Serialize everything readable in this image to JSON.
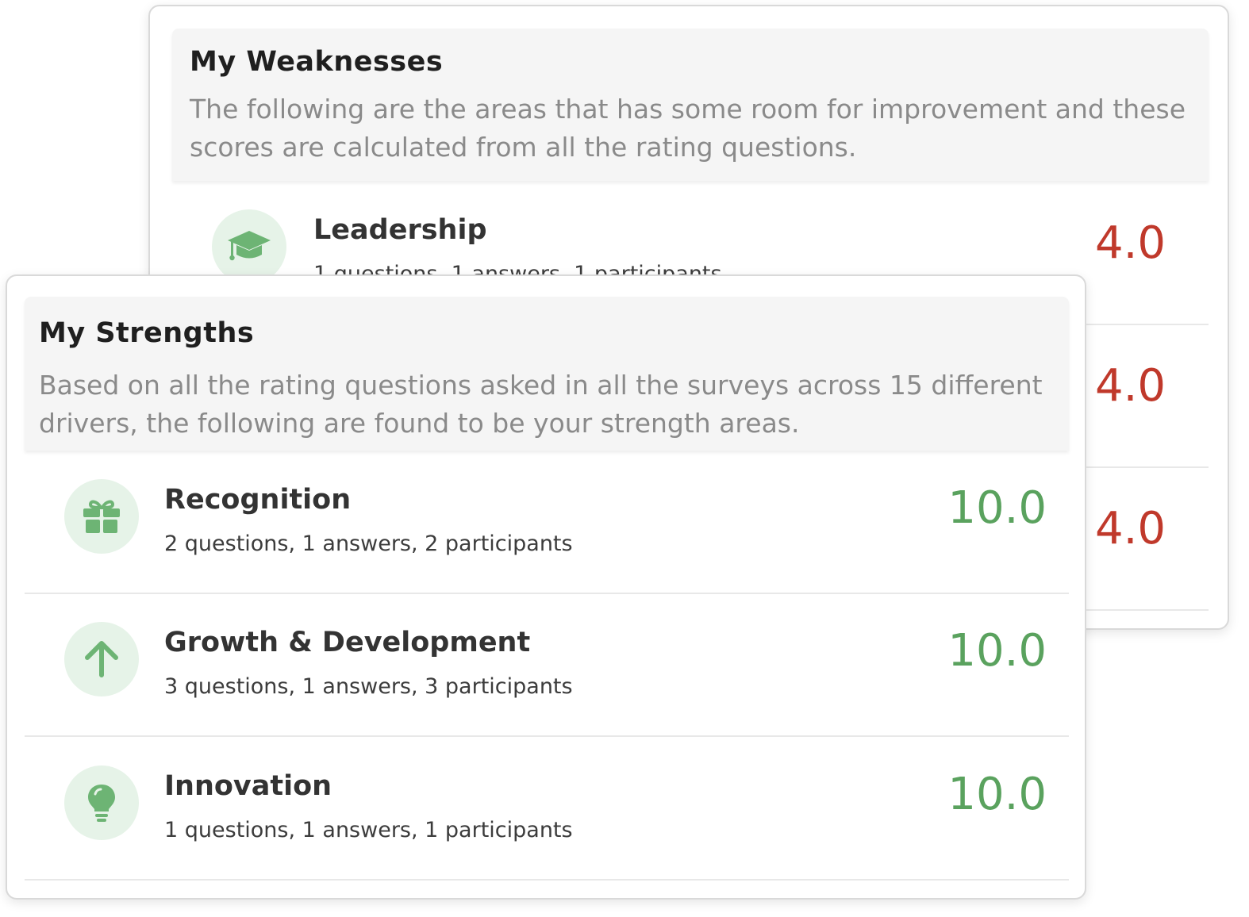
{
  "colors": {
    "weak_score": "#c0392b",
    "strong_score": "#5aa25e",
    "icon_bg": "#e6f3e8",
    "icon_fg": "#6db474",
    "header_bg": "#f5f5f5"
  },
  "weaknesses": {
    "title": "My Weaknesses",
    "description": "The following are the areas that has some room for improvement and these scores are calculated from all the rating questions.",
    "items": [
      {
        "icon": "graduation-cap-icon",
        "name": "Leadership",
        "meta": "1 questions, 1 answers, 1 participants",
        "score": "4.0"
      },
      {
        "icon": "",
        "name": "",
        "meta": "",
        "score": "4.0"
      },
      {
        "icon": "",
        "name": "",
        "meta": "",
        "score": "4.0"
      }
    ]
  },
  "strengths": {
    "title": "My Strengths",
    "description": "Based on all the rating questions asked in all the surveys across 15 different drivers, the following are found to be your strength areas.",
    "items": [
      {
        "icon": "gift-icon",
        "name": "Recognition",
        "meta": "2 questions, 1 answers, 2 participants",
        "score": "10.0"
      },
      {
        "icon": "arrow-up-icon",
        "name": "Growth & Development",
        "meta": "3 questions, 1 answers, 3 participants",
        "score": "10.0"
      },
      {
        "icon": "lightbulb-icon",
        "name": "Innovation",
        "meta": "1 questions, 1 answers, 1 participants",
        "score": "10.0"
      }
    ]
  }
}
